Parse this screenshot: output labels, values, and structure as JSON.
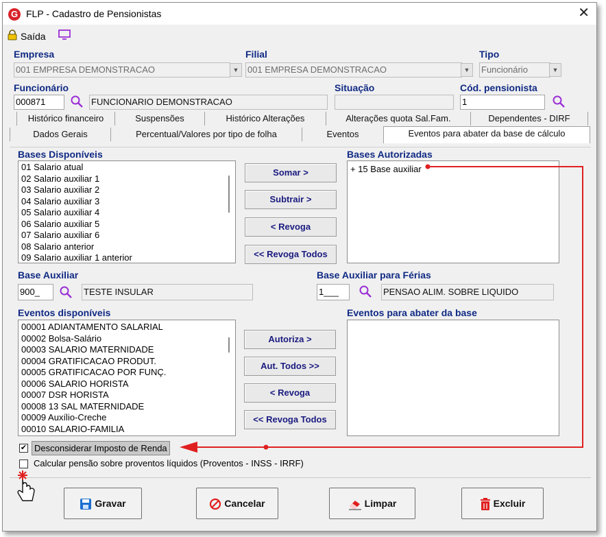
{
  "window": {
    "title": "FLP - Cadastro de Pensionistas",
    "close_glyph": "✕",
    "logo_letter": "G"
  },
  "toolbar": {
    "saida_label": "Saída"
  },
  "header": {
    "empresa": {
      "label": "Empresa",
      "value": "001 EMPRESA DEMONSTRACAO"
    },
    "filial": {
      "label": "Filial",
      "value": "001 EMPRESA DEMONSTRACAO"
    },
    "tipo": {
      "label": "Tipo",
      "value": "Funcionário"
    },
    "funcionario": {
      "label": "Funcionário",
      "code": "000871",
      "name": "FUNCIONARIO DEMONSTRACAO"
    },
    "situacao": {
      "label": "Situação",
      "value": ""
    },
    "cod_pensionista": {
      "label": "Cód. pensionista",
      "value": "1"
    }
  },
  "tabs_row1": [
    "Histórico financeiro",
    "Suspensões",
    "Histórico Alterações",
    "Alterações quota Sal.Fam.",
    "Dependentes - DIRF"
  ],
  "tabs_row2": [
    "Dados Gerais",
    "Percentual/Valores por tipo de folha",
    "Eventos",
    "Eventos para abater da base de cálculo"
  ],
  "bases": {
    "disponiveis_label": "Bases Disponíveis",
    "autorizadas_label": "Bases Autorizadas",
    "disponiveis": [
      "01 Salario atual",
      "02 Salario auxiliar 1",
      "03 Salario auxiliar 2",
      "04 Salario auxiliar 3",
      "05 Salario auxiliar 4",
      "06 Salario auxiliar 5",
      "07 Salario auxiliar 6",
      "08 Salario anterior",
      "09 Salario auxiliar 1 anterior"
    ],
    "autorizadas": [
      "+ 15 Base auxiliar"
    ],
    "buttons": [
      "Somar >",
      "Subtrair >",
      "< Revoga",
      "<< Revoga Todos"
    ]
  },
  "base_auxiliar": {
    "label": "Base Auxiliar",
    "code": "900_",
    "desc": "TESTE INSULAR"
  },
  "base_auxiliar_ferias": {
    "label": "Base Auxiliar para Férias",
    "code": "1___",
    "desc": "PENSAO ALIM. SOBRE LIQUIDO"
  },
  "eventos": {
    "disponiveis_label": "Eventos disponíveis",
    "abater_label": "Eventos para abater da base",
    "disponiveis": [
      "00001 ADIANTAMENTO SALARIAL",
      "00002 Bolsa-Salário",
      "00003 SALARIO MATERNIDADE",
      "00004 GRATIFICACAO PRODUT.",
      "00005 GRATIFICACAO POR FUNÇ.",
      "00006 SALARIO HORISTA",
      "00007 DSR HORISTA",
      "00008 13 SAL MATERNIDADE",
      "00009 Auxílio-Creche",
      "00010 SALARIO-FAMILIA"
    ],
    "abater": [],
    "buttons": [
      "Autoriza >",
      "Aut. Todos >>",
      "< Revoga",
      "<< Revoga Todos"
    ]
  },
  "options": {
    "desconsiderar_ir": {
      "label": "Desconsiderar Imposto de Renda",
      "checked": true
    },
    "calcular_pensao": {
      "label": "Calcular pensão sobre proventos líquidos (Proventos - INSS - IRRF)",
      "checked": false
    }
  },
  "footer": {
    "gravar": "Gravar",
    "cancelar": "Cancelar",
    "limpar": "Limpar",
    "excluir": "Excluir"
  },
  "colors": {
    "label_blue": "#102a84",
    "accent_red": "#e02020",
    "icon_purple": "#9b2fd6",
    "save_blue": "#1e6fd0"
  }
}
